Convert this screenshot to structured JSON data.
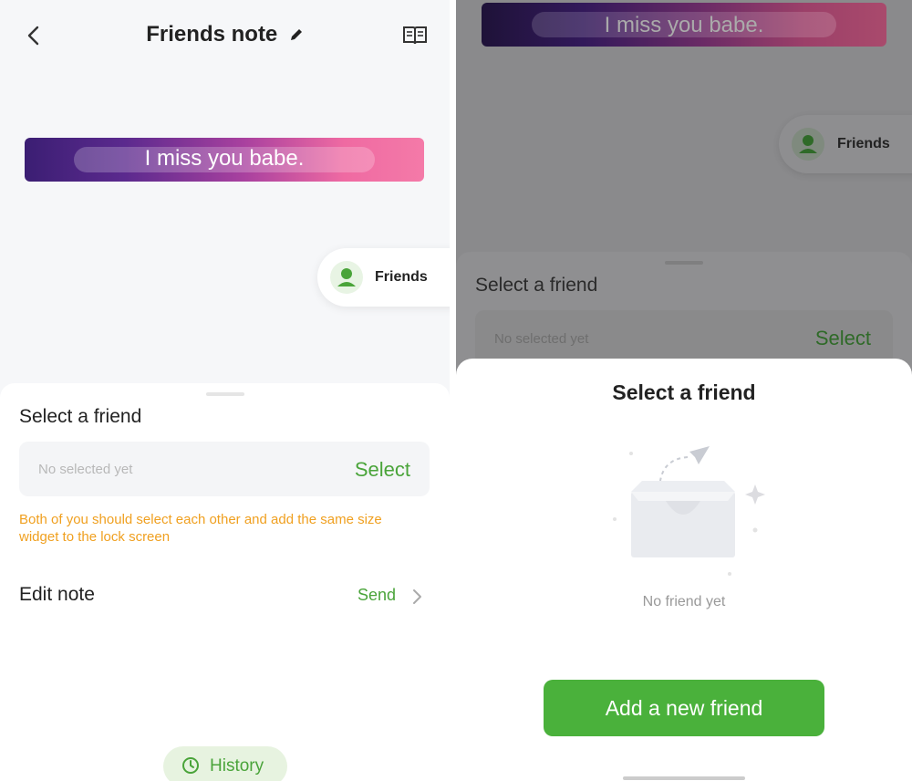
{
  "left": {
    "header": {
      "title": "Friends note"
    },
    "note": {
      "text": "I miss you babe."
    },
    "friends_chip": {
      "label": "Friends"
    },
    "sheet": {
      "heading": "Select a friend",
      "select_placeholder": "No selected yet",
      "select_action": "Select",
      "hint": "Both of you should select each other and add the same size widget to the lock screen",
      "edit_label": "Edit note",
      "send_label": "Send",
      "history_label": "History"
    }
  },
  "right": {
    "note": {
      "text": "I miss you babe."
    },
    "friends_chip": {
      "label": "Friends"
    },
    "under_sheet": {
      "heading": "Select a friend",
      "select_placeholder": "No selected yet",
      "select_action": "Select"
    },
    "modal": {
      "title": "Select a friend",
      "empty_text": "No friend yet",
      "add_button": "Add a new friend"
    }
  },
  "colors": {
    "accent_green": "#4aa43a",
    "hint_orange": "#f0a020",
    "gradient_start": "#3b1e73",
    "gradient_end": "#f47aa8"
  },
  "icons": [
    "back-arrow-icon",
    "pencil-icon",
    "book-icon",
    "friend-avatar-icon",
    "chevron-right-icon",
    "clock-icon",
    "empty-inbox-icon",
    "paper-plane-icon",
    "sparkle-icon"
  ]
}
